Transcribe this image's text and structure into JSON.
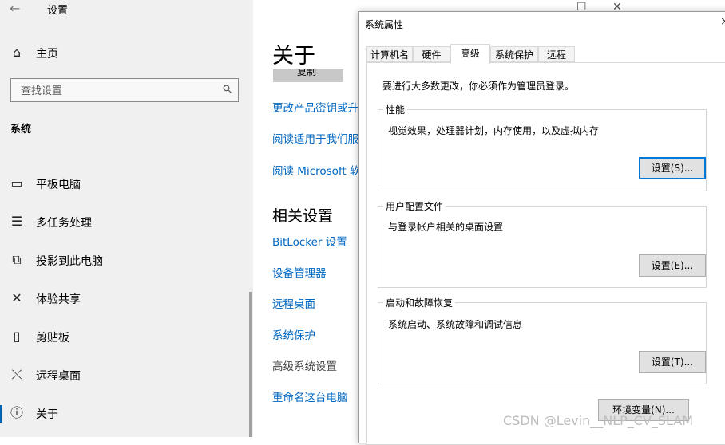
{
  "settings": {
    "app_title": "设置",
    "back_icon": "back-arrow-icon",
    "home_label": "主页",
    "search_placeholder": "查找设置",
    "section_title": "系统",
    "nav": [
      {
        "label": "平板电脑",
        "icon": "tablet-icon"
      },
      {
        "label": "多任务处理",
        "icon": "multitask-icon"
      },
      {
        "label": "投影到此电脑",
        "icon": "project-icon"
      },
      {
        "label": "体验共享",
        "icon": "share-icon"
      },
      {
        "label": "剪贴板",
        "icon": "clipboard-icon"
      },
      {
        "label": "远程桌面",
        "icon": "remote-icon"
      },
      {
        "label": "关于",
        "icon": "info-icon"
      }
    ],
    "main_heading": "关于",
    "copy_label": "复制",
    "links_top": [
      "更改产品密钥或升",
      "阅读适用于我们服",
      "阅读 Microsoft 软"
    ],
    "related_heading": "相关设置",
    "related_links": [
      "BitLocker 设置",
      "设备管理器",
      "远程桌面",
      "系统保护",
      "高级系统设置",
      "重命名这台电脑"
    ]
  },
  "dialog": {
    "title": "系统属性",
    "close": "×",
    "tabs": [
      "计算机名",
      "硬件",
      "高级",
      "系统保护",
      "远程"
    ],
    "active_tab": "高级",
    "notice": "要进行大多数更改，你必须作为管理员登录。",
    "performance": {
      "legend": "性能",
      "desc": "视觉效果，处理器计划，内存使用，以及虚拟内存",
      "button": "设置(S)..."
    },
    "profile": {
      "legend": "用户配置文件",
      "desc": "与登录帐户相关的桌面设置",
      "button": "设置(E)..."
    },
    "startup": {
      "legend": "启动和故障恢复",
      "desc": "系统启动、系统故障和调试信息",
      "button": "设置(T)..."
    },
    "env_button": "环境变量(N)..."
  },
  "watermark": "CSDN @Levin__NLP_CV_SLAM",
  "colors": {
    "link": "#0067c0",
    "accent": "#0078d7",
    "sidebar_bg": "#f0f0f0"
  }
}
